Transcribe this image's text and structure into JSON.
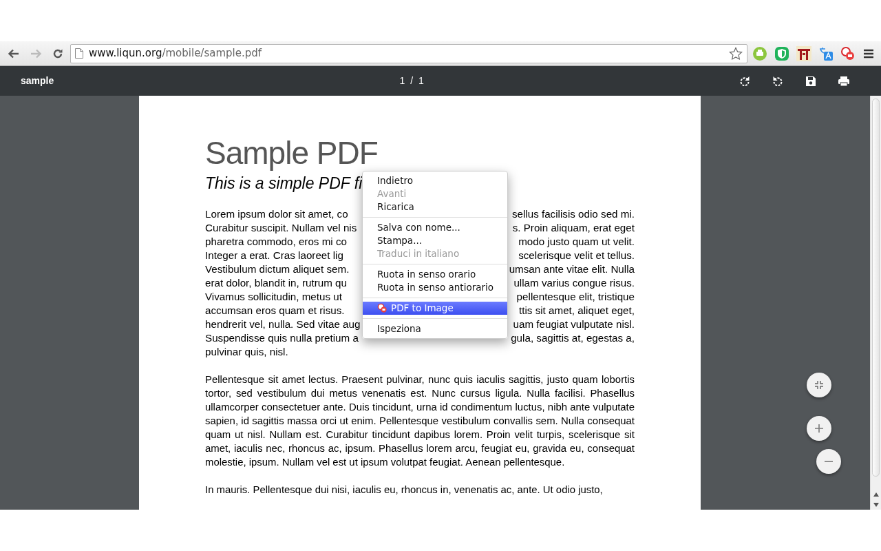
{
  "browser": {
    "back": {
      "disabled": false
    },
    "forward": {
      "disabled": true
    },
    "url_host": "www.liqun.org",
    "url_path": "/mobile/sample.pdf"
  },
  "pdf_toolbar": {
    "title": "sample",
    "page_current": "1",
    "page_separator": "/",
    "page_total": "1"
  },
  "document": {
    "title": "Sample PDF",
    "subtitle": "This is a simple PDF fi",
    "paragraph_1_lines": [
      {
        "left": "Lorem ipsum dolor sit amet, co",
        "right": "sellus facilisis odio sed mi."
      },
      {
        "left": "Curabitur suscipit. Nullam vel nis",
        "right": "s. Proin aliquam, erat eget"
      },
      {
        "left": "pharetra commodo, eros mi co",
        "right": "modo justo quam ut velit."
      },
      {
        "left": "Integer a erat. Cras laoreet lig",
        "right": "scelerisque velit et tellus."
      },
      {
        "left": "Vestibulum dictum aliquet sem.",
        "right": "umsan ante vitae elit. Nulla"
      },
      {
        "left": "erat dolor, blandit in, rutrum qu",
        "right": "ullam varius congue risus."
      },
      {
        "left": "Vivamus sollicitudin, metus ut",
        "right": "pellentesque elit, tristique"
      },
      {
        "left": "accumsan eros quam et risus.",
        "right": "ttis sit amet, aliquet eget,"
      },
      {
        "left": "hendrerit vel, nulla. Sed vitae aug",
        "right": "uam feugiat vulputate nisl."
      },
      {
        "left": "Suspendisse quis nulla pretium a",
        "right": "gula, sagittis at, egestas a,"
      },
      {
        "left": "pulvinar quis, nisl."
      }
    ],
    "paragraph_2": "Pellentesque sit amet lectus. Praesent pulvinar, nunc quis iaculis sagittis, justo quam lobortis tortor, sed vestibulum dui metus venenatis est. Nunc cursus ligula. Nulla facilisi. Phasellus ullamcorper consectetuer ante. Duis tincidunt, urna id condimentum luctus, nibh ante vulputate sapien, id sagittis massa orci ut enim. Pellentesque vestibulum convallis sem. Nulla consequat quam ut nisl. Nullam est. Curabitur tincidunt dapibus lorem. Proin velit turpis, scelerisque sit amet, iaculis nec, rhoncus ac, ipsum. Phasellus lorem arcu, feugiat eu, gravida eu, consequat molestie, ipsum. Nullam vel est ut ipsum volutpat feugiat. Aenean pellentesque.",
    "paragraph_3": "In mauris. Pellentesque dui nisi, iaculis eu, rhoncus in, venenatis ac, ante. Ut odio justo,"
  },
  "context_menu": [
    {
      "kind": "item",
      "label": "Indietro",
      "disabled": false,
      "selected": false
    },
    {
      "kind": "item",
      "label": "Avanti",
      "disabled": true,
      "selected": false
    },
    {
      "kind": "item",
      "label": "Ricarica",
      "disabled": false,
      "selected": false
    },
    {
      "kind": "separator"
    },
    {
      "kind": "item",
      "label": "Salva con nome...",
      "disabled": false,
      "selected": false
    },
    {
      "kind": "item",
      "label": "Stampa...",
      "disabled": false,
      "selected": false
    },
    {
      "kind": "item",
      "label": "Traduci in italiano",
      "disabled": true,
      "selected": false
    },
    {
      "kind": "separator"
    },
    {
      "kind": "item",
      "label": "Ruota in senso orario",
      "disabled": false,
      "selected": false
    },
    {
      "kind": "item",
      "label": "Ruota in senso antiorario",
      "disabled": false,
      "selected": false
    },
    {
      "kind": "separator"
    },
    {
      "kind": "extension",
      "label": "PDF to Image",
      "disabled": false,
      "selected": true
    },
    {
      "kind": "separator"
    },
    {
      "kind": "item",
      "label": "Ispeziona",
      "disabled": false,
      "selected": false
    }
  ]
}
